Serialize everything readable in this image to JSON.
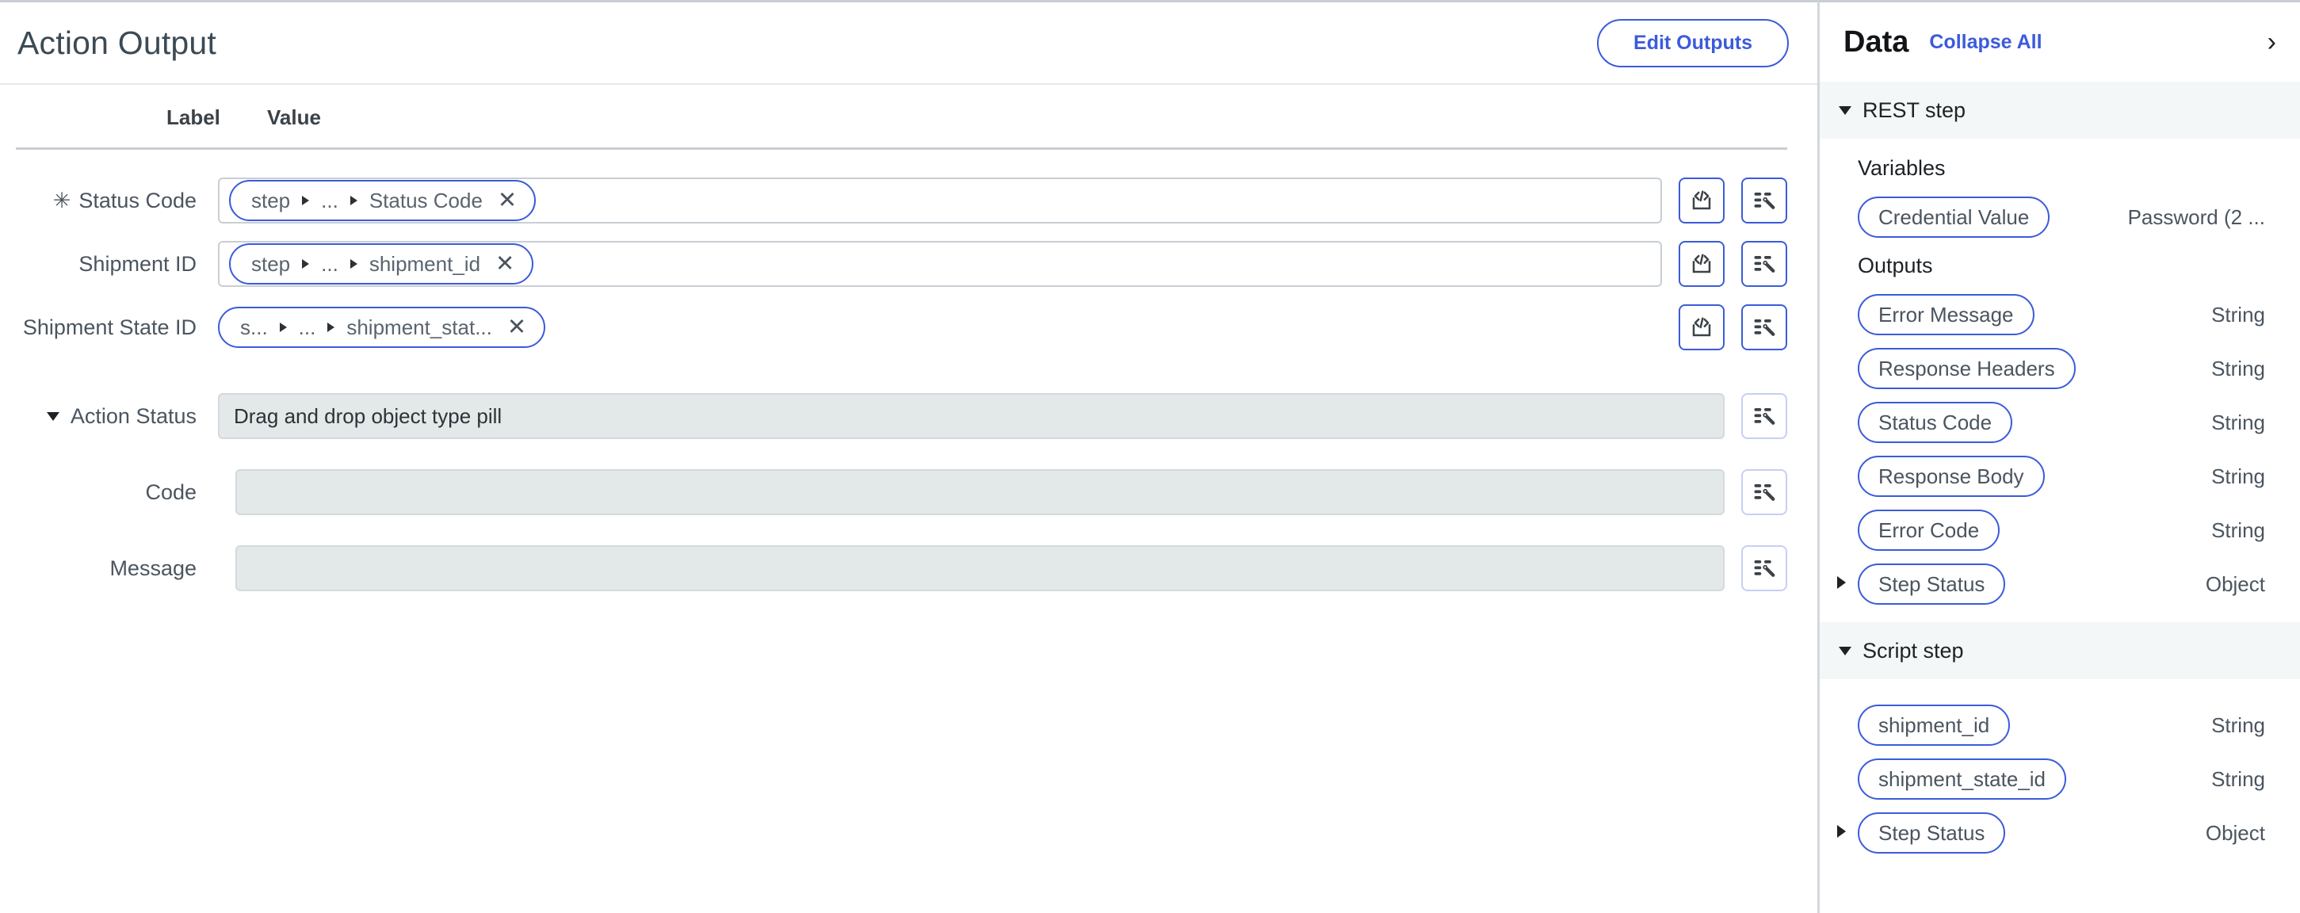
{
  "header": {
    "title": "Action Output",
    "edit_outputs_label": "Edit Outputs"
  },
  "table": {
    "col_label": "Label",
    "col_value": "Value"
  },
  "fields": [
    {
      "label": "Status Code",
      "required": true,
      "required_marker": "✳",
      "pill": {
        "first": "step",
        "middle": "...",
        "last": "Status Code",
        "remove": "✕"
      },
      "has_input_box": true,
      "buttons": [
        "code-icon",
        "magic-list-icon"
      ]
    },
    {
      "label": "Shipment ID",
      "required": false,
      "pill": {
        "first": "step",
        "middle": "...",
        "last": "shipment_id",
        "remove": "✕"
      },
      "has_input_box": true,
      "buttons": [
        "code-icon",
        "magic-list-icon"
      ]
    },
    {
      "label": "Shipment State ID",
      "required": false,
      "pill": {
        "first": "s...",
        "middle": "...",
        "last": "shipment_stat...",
        "remove": "✕"
      },
      "has_input_box": false,
      "buttons": [
        "code-icon",
        "magic-list-icon"
      ]
    }
  ],
  "action_status": {
    "group_label": "Action Status",
    "drop_hint": "Drag and drop object type pill",
    "sub_rows": [
      {
        "label": "Code",
        "value": ""
      },
      {
        "label": "Message",
        "value": ""
      }
    ]
  },
  "data_panel": {
    "title": "Data",
    "collapse_all": "Collapse All",
    "chevron": "›",
    "groups": [
      {
        "name": "REST step",
        "expanded": true,
        "sections": [
          {
            "heading": "Variables",
            "items": [
              {
                "name": "Credential Value",
                "type": "Password (2 ...",
                "expandable": false
              }
            ]
          },
          {
            "heading": "Outputs",
            "items": [
              {
                "name": "Error Message",
                "type": "String",
                "expandable": false
              },
              {
                "name": "Response Headers",
                "type": "String",
                "expandable": false
              },
              {
                "name": "Status Code",
                "type": "String",
                "expandable": false
              },
              {
                "name": "Response Body",
                "type": "String",
                "expandable": false
              },
              {
                "name": "Error Code",
                "type": "String",
                "expandable": false
              },
              {
                "name": "Step Status",
                "type": "Object",
                "expandable": true
              }
            ]
          }
        ]
      },
      {
        "name": "Script step",
        "expanded": true,
        "sections": [
          {
            "heading": "",
            "items": [
              {
                "name": "shipment_id",
                "type": "String",
                "expandable": false
              },
              {
                "name": "shipment_state_id",
                "type": "String",
                "expandable": false
              },
              {
                "name": "Step Status",
                "type": "Object",
                "expandable": true
              }
            ]
          }
        ]
      }
    ]
  },
  "colors": {
    "accent": "#3b5bdb",
    "text": "#4b5560",
    "title": "#3c4a54",
    "readonly_bg": "#e3e8e8",
    "group_bg": "#f4f7f7",
    "border": "#c9ced4"
  }
}
